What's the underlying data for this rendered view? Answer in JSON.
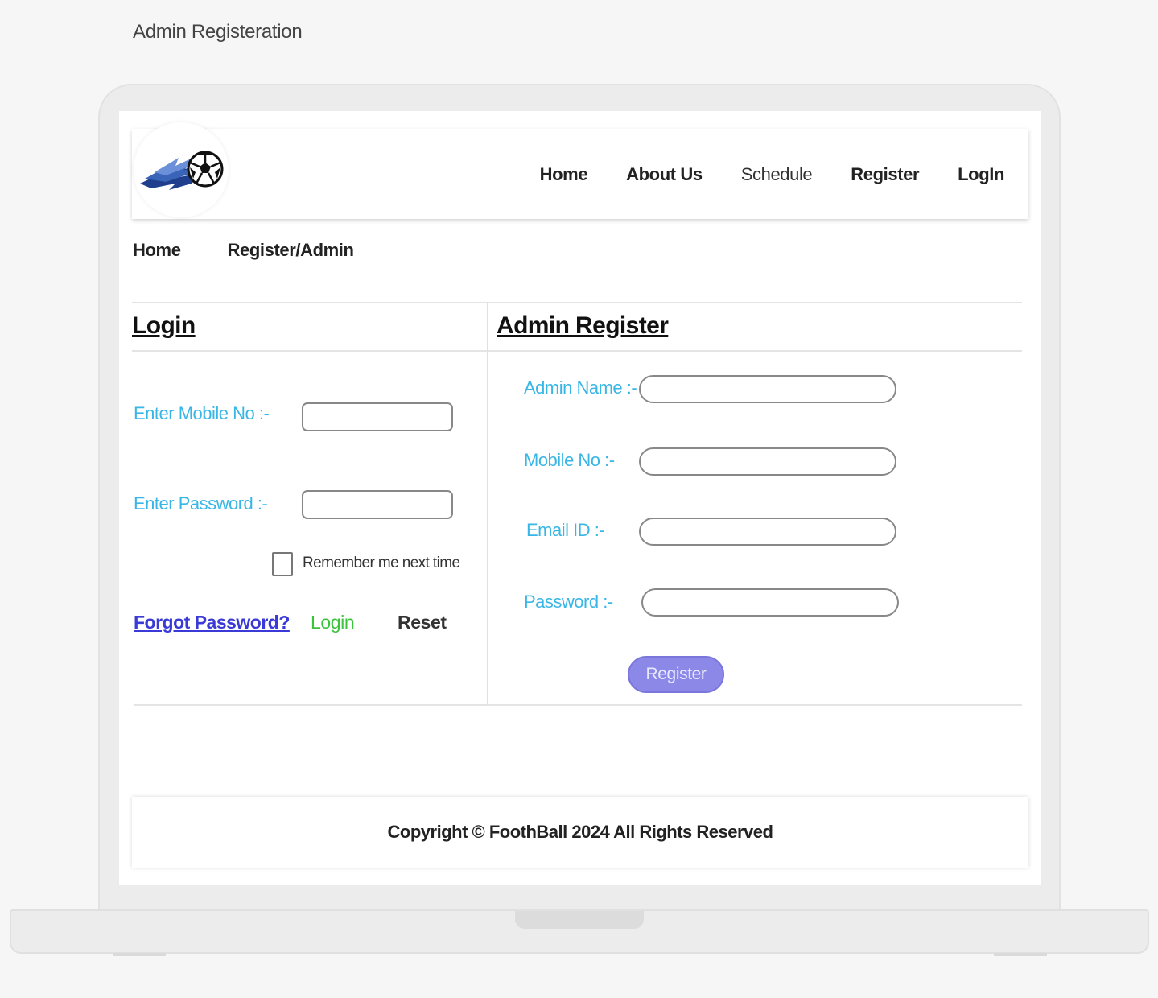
{
  "page": {
    "caption": "Admin Registeration"
  },
  "nav": {
    "items": [
      "Home",
      "About Us",
      "Schedule",
      "Register",
      "LogIn"
    ]
  },
  "breadcrumb": {
    "items": [
      "Home",
      "Register/Admin"
    ]
  },
  "login": {
    "title": "Login",
    "mobile_label": "Enter Mobile No :-",
    "mobile_value": "",
    "password_label": "Enter Password :-",
    "password_value": "",
    "remember_label": "Remember me next time",
    "forgot_label": "Forgot Password?",
    "login_label": "Login",
    "reset_label": "Reset"
  },
  "register": {
    "title": "Admin Register",
    "name_label": "Admin Name :-",
    "mobile_label": "Mobile No :-",
    "email_label": "Email ID :-",
    "password_label": "Password :-",
    "submit_label": "Register"
  },
  "footer": {
    "copyright": "Copyright © FoothBall 2024 All Rights Reserved"
  },
  "colors": {
    "label_blue": "#38b6e6",
    "link_blue": "#3a3ad6",
    "login_green": "#3cc33c",
    "register_purple": "#8c88e8"
  }
}
